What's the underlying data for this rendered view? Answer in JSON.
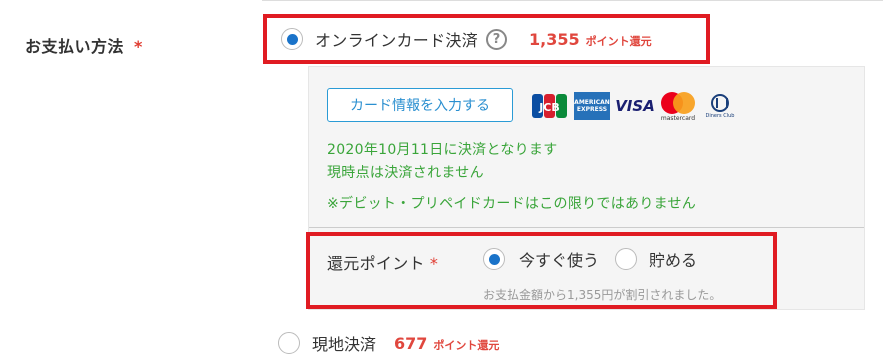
{
  "payment": {
    "label": "お支払い方法",
    "required_mark": "*",
    "options": [
      {
        "label": "オンラインカード決済",
        "help": "?",
        "points": "1,355",
        "points_unit": "ポイント還元",
        "selected": true
      },
      {
        "label": "現地決済",
        "points": "677",
        "points_unit": "ポイント還元",
        "selected": false
      }
    ]
  },
  "card_panel": {
    "button_label": "カード情報を入力する",
    "brands": {
      "jcb": "JCB",
      "amex_line1": "AMERICAN",
      "amex_line2": "EXPRESS",
      "visa": "VISA",
      "mastercard": "mastercard",
      "diners": "Diners Club"
    },
    "notes": [
      "2020年10月11日に決済となります",
      "現時点は決済されません",
      "※デビット・プリペイドカードはこの限りではありません"
    ]
  },
  "reward_points": {
    "label": "還元ポイント",
    "required_mark": "*",
    "options": [
      {
        "label": "今すぐ使う",
        "selected": true
      },
      {
        "label": "貯める",
        "selected": false
      }
    ],
    "discount_note": "お支払金額から1,355円が割引されました。"
  },
  "colors": {
    "highlight_border": "#e01b22",
    "points": "#e0473e",
    "note_green": "#3aa53a",
    "button_blue": "#2a9bd5",
    "radio_blue": "#1a73c9"
  }
}
